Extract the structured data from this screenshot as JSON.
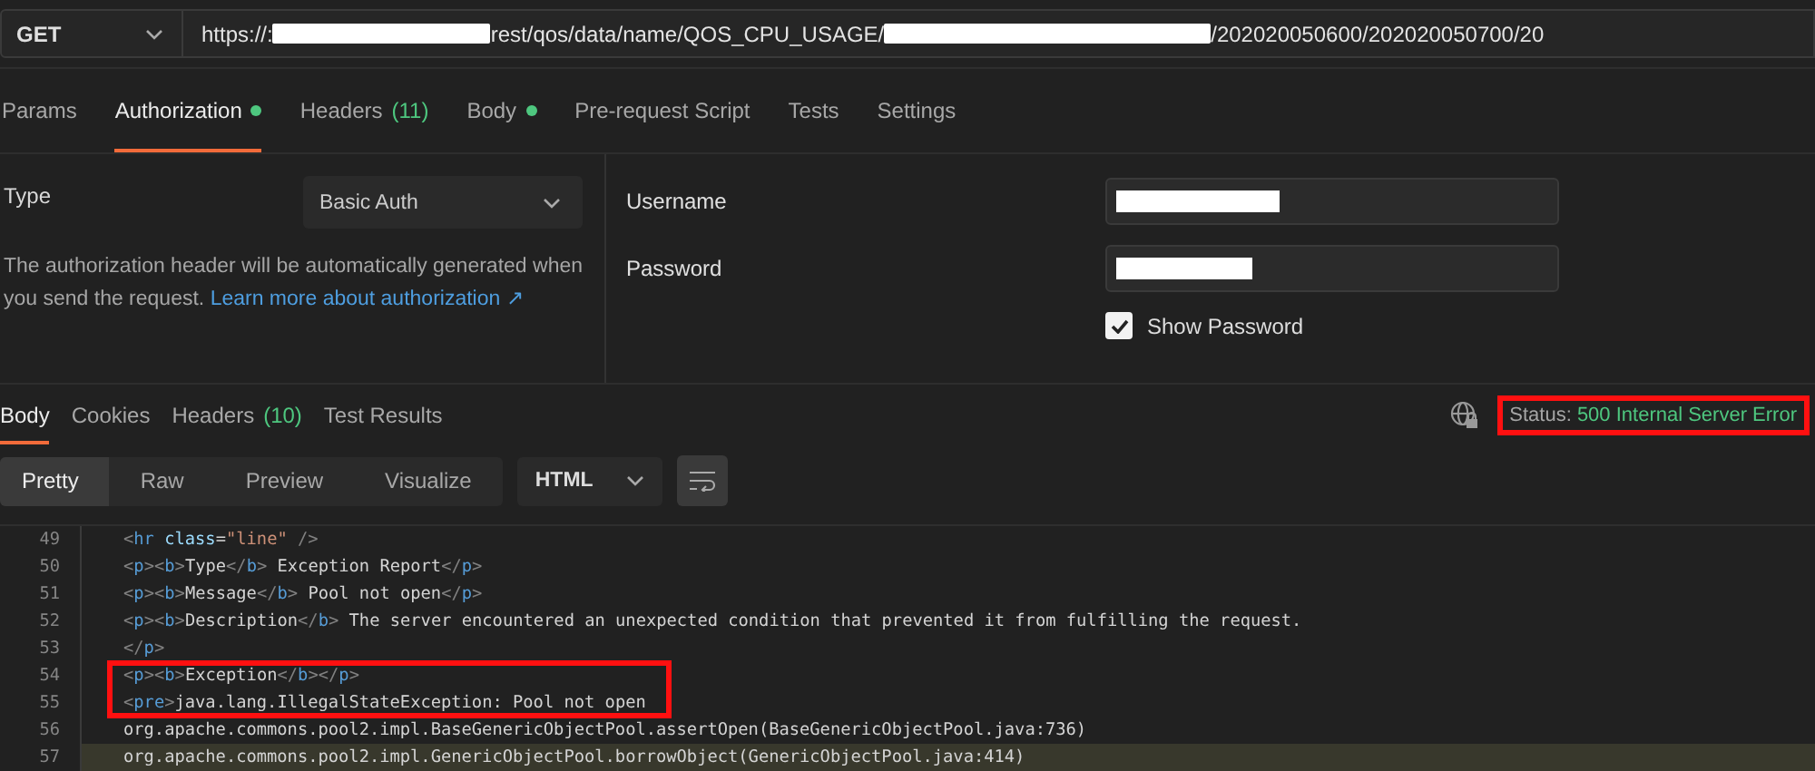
{
  "request": {
    "method": "GET",
    "url_parts": [
      {
        "kind": "text",
        "text": "https://:"
      },
      {
        "kind": "redacted"
      },
      {
        "kind": "text",
        "text": "rest/qos/data/name/QOS_CPU_USAGE/"
      },
      {
        "kind": "redacted"
      },
      {
        "kind": "text",
        "text": "/202020050600/202020050700/20"
      }
    ]
  },
  "request_tabs": [
    {
      "label": "Params",
      "selected": false,
      "dot": false
    },
    {
      "label": "Authorization",
      "selected": true,
      "dot": true
    },
    {
      "label": "Headers",
      "count": "(11)",
      "selected": false,
      "dot": false
    },
    {
      "label": "Body",
      "selected": false,
      "dot": true
    },
    {
      "label": "Pre-request Script",
      "selected": false,
      "dot": false
    },
    {
      "label": "Tests",
      "selected": false,
      "dot": false
    },
    {
      "label": "Settings",
      "selected": false,
      "dot": false
    }
  ],
  "auth": {
    "type_label": "Type",
    "type_value": "Basic Auth",
    "description": "The authorization header will be automatically generated when you send the request.",
    "link": "Learn more about authorization ↗",
    "fields": [
      {
        "label": "Username",
        "redacted": true
      },
      {
        "label": "Password",
        "redacted": true
      }
    ],
    "show_password": {
      "label": "Show Password",
      "checked": true
    }
  },
  "response_tabs": [
    {
      "label": "Body",
      "selected": true
    },
    {
      "label": "Cookies",
      "selected": false
    },
    {
      "label": "Headers",
      "count": "(10)",
      "selected": false
    },
    {
      "label": "Test Results",
      "selected": false
    }
  ],
  "status": {
    "label": "Status:",
    "value": "500 Internal Server Error",
    "boxed": true
  },
  "view_modes": [
    {
      "label": "Pretty",
      "selected": true
    },
    {
      "label": "Raw",
      "selected": false
    },
    {
      "label": "Preview",
      "selected": false
    },
    {
      "label": "Visualize",
      "selected": false
    }
  ],
  "format": "HTML",
  "code": [
    {
      "number": "49",
      "text": "<hr class=\"line\" />",
      "boxed": false,
      "current": false
    },
    {
      "number": "50",
      "text": "<p><b>Type</b> Exception Report</p>",
      "boxed": false,
      "current": false
    },
    {
      "number": "51",
      "text": "<p><b>Message</b> Pool not open</p>",
      "boxed": false,
      "current": false
    },
    {
      "number": "52",
      "text": "<p><b>Description</b> The server encountered an unexpected condition that prevented it from fulfilling the request.",
      "boxed": false,
      "current": false
    },
    {
      "number": "53",
      "text": "</p>",
      "boxed": false,
      "current": false
    },
    {
      "number": "54",
      "text": "<p><b>Exception</b></p>",
      "boxed": true,
      "current": false
    },
    {
      "number": "55",
      "text": "<pre>java.lang.IllegalStateException: Pool not open",
      "boxed": true,
      "current": false
    },
    {
      "number": "56",
      "text": "org.apache.commons.pool2.impl.BaseGenericObjectPool.assertOpen(BaseGenericObjectPool.java:736)",
      "boxed": false,
      "current": false
    },
    {
      "number": "57",
      "text": "org.apache.commons.pool2.impl.GenericObjectPool.borrowObject(GenericObjectPool.java:414)",
      "boxed": false,
      "current": true
    }
  ]
}
